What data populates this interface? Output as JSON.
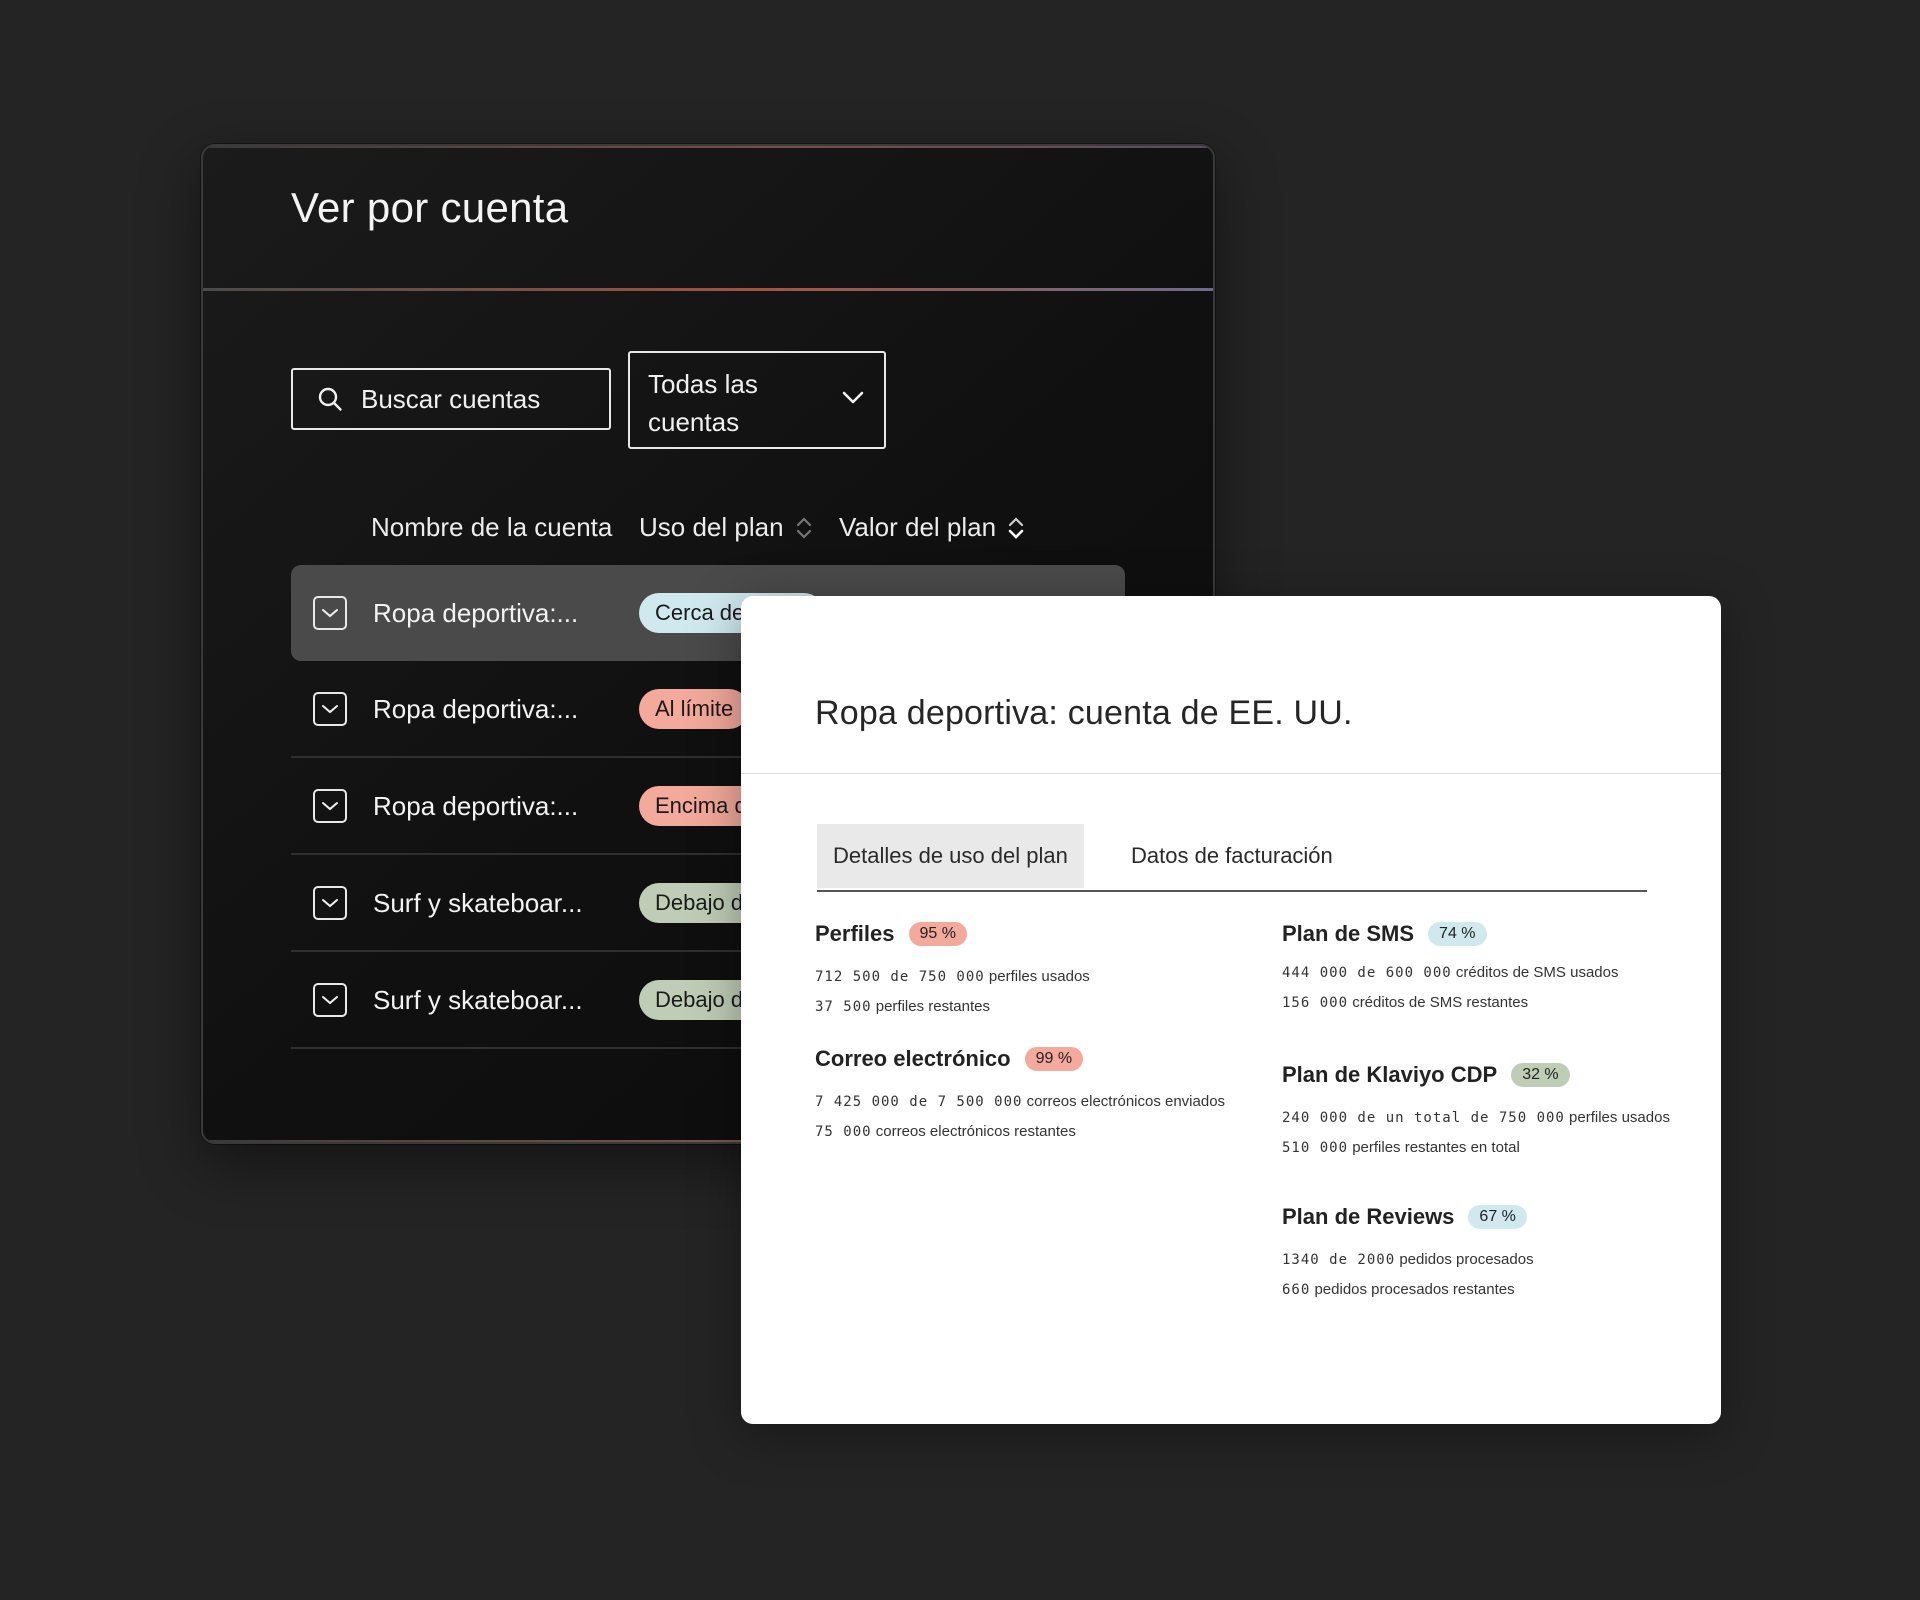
{
  "accounts_panel": {
    "title": "Ver por cuenta",
    "search": {
      "placeholder": "Buscar cuentas"
    },
    "filter": {
      "selected": "Todas las cuentas"
    },
    "columns": {
      "name": "Nombre de la cuenta",
      "usage": "Uso del plan",
      "value": "Valor del plan"
    },
    "rows": [
      {
        "name": "Ropa deportiva:...",
        "status": "Cerca del límite",
        "status_color": "#cfe9ef",
        "active": true
      },
      {
        "name": "Ropa deportiva:...",
        "status": "Al límite",
        "status_color": "#f3a99b"
      },
      {
        "name": "Ropa deportiva:...",
        "status": "Encima del límite",
        "status_color": "#f3a99b"
      },
      {
        "name": "Surf y skateboar...",
        "status": "Debajo del límite",
        "status_color": "#bfcdb6"
      },
      {
        "name": "Surf y skateboar...",
        "status": "Debajo del límite",
        "status_color": "#bfcdb6"
      }
    ]
  },
  "detail": {
    "title": "Ropa deportiva: cuenta de EE. UU.",
    "tabs": [
      "Detalles de uso del plan",
      "Datos de facturación"
    ],
    "metrics": {
      "perfiles": {
        "title": "Perfiles",
        "pct": "95 %",
        "pct_color": "#f3a99b",
        "line1_num": "712 500 de 750 000",
        "line1_text": "perfiles usados",
        "line2_num": "37 500",
        "line2_text": "perfiles restantes"
      },
      "correo": {
        "title": "Correo electrónico",
        "pct": "99 %",
        "pct_color": "#f3a99b",
        "line1_num": "7 425 000 de 7 500 000",
        "line1_text": "correos electrónicos enviados",
        "line2_num": "75 000",
        "line2_text": "correos electrónicos restantes"
      },
      "sms": {
        "title": "Plan de SMS",
        "pct": "74 %",
        "pct_color": "#cfe9ef",
        "line1_num": "444 000 de 600 000",
        "line1_text": "créditos de SMS usados",
        "line2_num": "156 000",
        "line2_text": "créditos de SMS restantes"
      },
      "cdp": {
        "title": "Plan de Klaviyo CDP",
        "pct": "32 %",
        "pct_color": "#bfcdb6",
        "line1_num": "240 000 de un total de 750 000",
        "line1_text": "perfiles usados",
        "line2_num": "510 000",
        "line2_text": "perfiles restantes en total"
      },
      "reviews": {
        "title": "Plan de Reviews",
        "pct": "67 %",
        "pct_color": "#cfe9ef",
        "line1_num": "1340 de 2000",
        "line1_text": "pedidos procesados",
        "line2_num": "660",
        "line2_text": "pedidos procesados restantes"
      }
    }
  }
}
